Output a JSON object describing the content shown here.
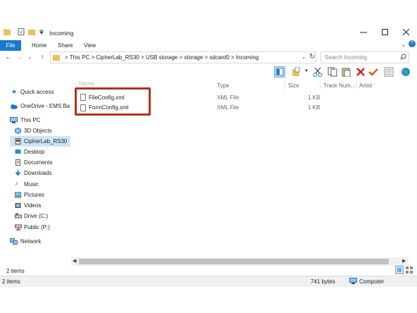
{
  "window": {
    "title": "Incoming",
    "controls": [
      "—",
      "☐",
      "✕"
    ]
  },
  "ribbon": {
    "tabs": [
      "File",
      "Home",
      "Share",
      "View"
    ]
  },
  "address": {
    "breadcrumb": [
      "This PC",
      "CipherLab_RS30",
      "USB storage",
      "storage",
      "sdcard0",
      "Incoming"
    ],
    "search_placeholder": "Search Incoming"
  },
  "nav": {
    "items": [
      {
        "label": "Quick access",
        "icon": "star-icon"
      },
      {
        "label": "OneDrive - EMS Barco",
        "icon": "cloud-icon"
      },
      {
        "label": "This PC",
        "icon": "computer-icon"
      },
      {
        "label": "3D Objects",
        "icon": "cube-icon"
      },
      {
        "label": "CipherLab_RS30",
        "icon": "device-icon"
      },
      {
        "label": "Desktop",
        "icon": "desktop-icon"
      },
      {
        "label": "Documents",
        "icon": "documents-icon"
      },
      {
        "label": "Downloads",
        "icon": "download-icon"
      },
      {
        "label": "Music",
        "icon": "music-icon"
      },
      {
        "label": "Pictures",
        "icon": "pictures-icon"
      },
      {
        "label": "Videos",
        "icon": "videos-icon"
      },
      {
        "label": "Drive (C:)",
        "icon": "drive-icon"
      },
      {
        "label": "Public (P:)",
        "icon": "network-drive-icon"
      },
      {
        "label": "Network",
        "icon": "network-icon"
      }
    ]
  },
  "columns": {
    "name": "Name",
    "type": "Type",
    "size": "Size",
    "track": "Track Num...",
    "artist": "Artist"
  },
  "files": [
    {
      "name": "FileConfig.xml",
      "type": "XML File",
      "size": "1 KB"
    },
    {
      "name": "FormConfig.xml",
      "type": "XML File",
      "size": "1 KB"
    }
  ],
  "status": {
    "items_count": "2 items",
    "bottom_items": "2 items",
    "bytes": "741 bytes",
    "location": "Computer"
  },
  "colors": {
    "accent": "#1979ca",
    "highlight_box": "#b5301f",
    "selection": "#cce4f7"
  }
}
